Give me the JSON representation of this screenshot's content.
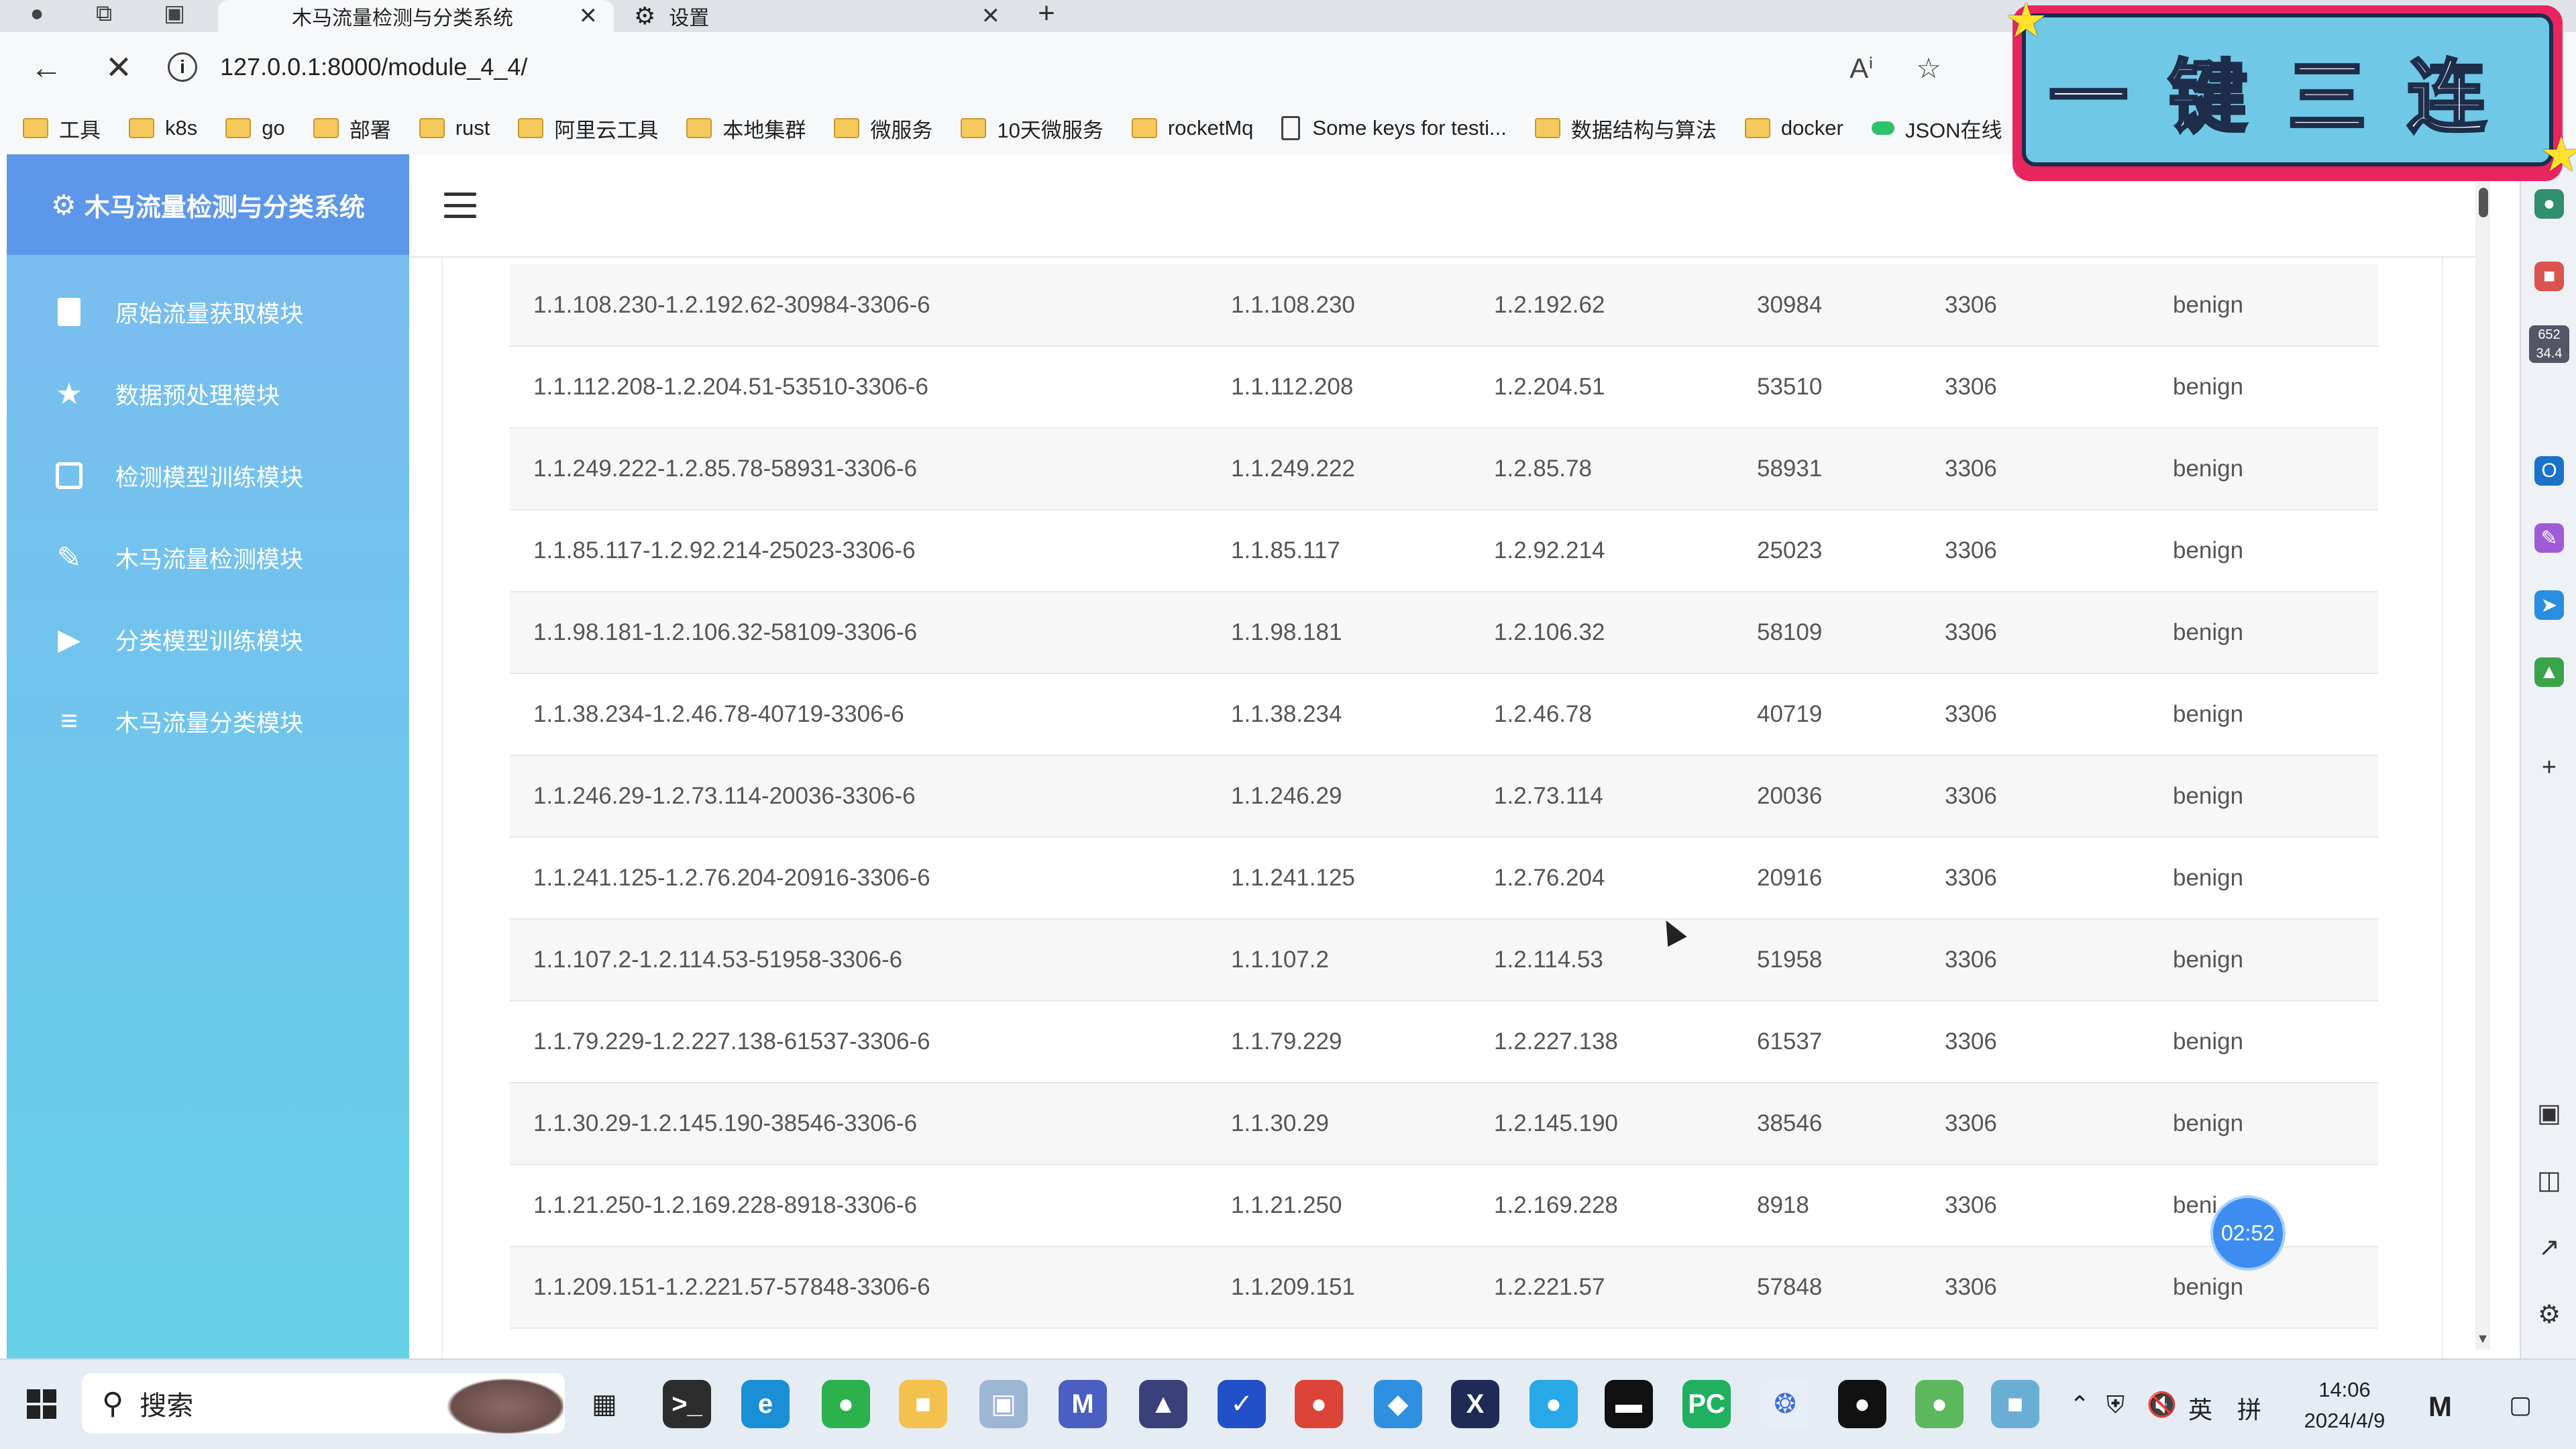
{
  "browser": {
    "tabs": [
      {
        "title": "木马流量检测与分类系统",
        "active": true
      },
      {
        "title": "设置",
        "active": false
      }
    ],
    "url": "127.0.0.1:8000/module_4_4/",
    "bookmarks": [
      {
        "label": "工具",
        "icon": "folder-icon"
      },
      {
        "label": "k8s",
        "icon": "folder-icon"
      },
      {
        "label": "go",
        "icon": "folder-icon"
      },
      {
        "label": "部署",
        "icon": "folder-icon"
      },
      {
        "label": "rust",
        "icon": "folder-icon"
      },
      {
        "label": "阿里云工具",
        "icon": "folder-icon"
      },
      {
        "label": "本地集群",
        "icon": "folder-icon"
      },
      {
        "label": "微服务",
        "icon": "folder-icon"
      },
      {
        "label": "10天微服务",
        "icon": "folder-icon"
      },
      {
        "label": "rocketMq",
        "icon": "folder-icon"
      },
      {
        "label": "Some keys for testi...",
        "icon": "page-icon"
      },
      {
        "label": "数据结构与算法",
        "icon": "folder-icon"
      },
      {
        "label": "docker",
        "icon": "folder-icon"
      },
      {
        "label": "JSON在线",
        "icon": "json-icon"
      }
    ]
  },
  "promo": {
    "text": "一键三连"
  },
  "app": {
    "brand": "木马流量检测与分类系统",
    "menu": [
      {
        "label": "原始流量获取模块",
        "icon": "file-icon"
      },
      {
        "label": "数据预处理模块",
        "icon": "star-icon"
      },
      {
        "label": "检测模型训练模块",
        "icon": "box-play-icon"
      },
      {
        "label": "木马流量检测模块",
        "icon": "edit-icon"
      },
      {
        "label": "分类模型训练模块",
        "icon": "play-icon"
      },
      {
        "label": "木马流量分类模块",
        "icon": "indent-icon"
      }
    ]
  },
  "table": {
    "rows": [
      [
        "1.1.108.230-1.2.192.62-30984-3306-6",
        "1.1.108.230",
        "1.2.192.62",
        "30984",
        "3306",
        "benign"
      ],
      [
        "1.1.112.208-1.2.204.51-53510-3306-6",
        "1.1.112.208",
        "1.2.204.51",
        "53510",
        "3306",
        "benign"
      ],
      [
        "1.1.249.222-1.2.85.78-58931-3306-6",
        "1.1.249.222",
        "1.2.85.78",
        "58931",
        "3306",
        "benign"
      ],
      [
        "1.1.85.117-1.2.92.214-25023-3306-6",
        "1.1.85.117",
        "1.2.92.214",
        "25023",
        "3306",
        "benign"
      ],
      [
        "1.1.98.181-1.2.106.32-58109-3306-6",
        "1.1.98.181",
        "1.2.106.32",
        "58109",
        "3306",
        "benign"
      ],
      [
        "1.1.38.234-1.2.46.78-40719-3306-6",
        "1.1.38.234",
        "1.2.46.78",
        "40719",
        "3306",
        "benign"
      ],
      [
        "1.1.246.29-1.2.73.114-20036-3306-6",
        "1.1.246.29",
        "1.2.73.114",
        "20036",
        "3306",
        "benign"
      ],
      [
        "1.1.241.125-1.2.76.204-20916-3306-6",
        "1.1.241.125",
        "1.2.76.204",
        "20916",
        "3306",
        "benign"
      ],
      [
        "1.1.107.2-1.2.114.53-51958-3306-6",
        "1.1.107.2",
        "1.2.114.53",
        "51958",
        "3306",
        "benign"
      ],
      [
        "1.1.79.229-1.2.227.138-61537-3306-6",
        "1.1.79.229",
        "1.2.227.138",
        "61537",
        "3306",
        "benign"
      ],
      [
        "1.1.30.29-1.2.145.190-38546-3306-6",
        "1.1.30.29",
        "1.2.145.190",
        "38546",
        "3306",
        "benign"
      ],
      [
        "1.1.21.250-1.2.169.228-8918-3306-6",
        "1.1.21.250",
        "1.2.169.228",
        "8918",
        "3306",
        "beni"
      ],
      [
        "1.1.209.151-1.2.221.57-57848-3306-6",
        "1.1.209.151",
        "1.2.221.57",
        "57848",
        "3306",
        "benign"
      ]
    ]
  },
  "timer": "02:52",
  "taskbar": {
    "search_placeholder": "搜索",
    "ime_lang": "英",
    "ime_mode": "拼",
    "time": "14:06",
    "date": "2024/4/9"
  },
  "edge_sidebar": {
    "speed_up": "652",
    "speed_down": "34.4"
  },
  "colors": {
    "sidebar_top": "#7cbcf0",
    "sidebar_bottom": "#66d0e6",
    "brand_bg": "#4678e6",
    "promo_border": "#e8255f",
    "promo_fill": "#6fc8e6",
    "timer_bg": "#3d8df0"
  }
}
